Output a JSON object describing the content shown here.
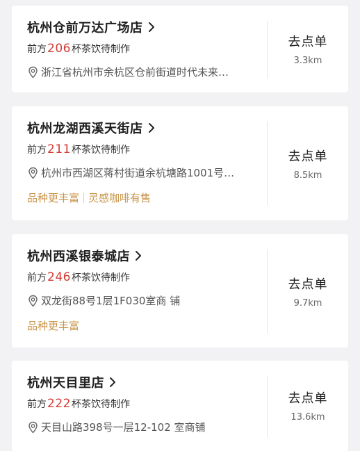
{
  "stores": [
    {
      "name": "杭州仓前万达广场店",
      "queue_prefix": "前方",
      "queue_count": "206",
      "queue_suffix": "杯茶饮待制作",
      "address": "浙江省杭州市余杭区仓前街道时代未来…",
      "tags": [],
      "order_label": "去点单",
      "distance": "3.3km"
    },
    {
      "name": "杭州龙湖西溪天街店",
      "queue_prefix": "前方",
      "queue_count": "211",
      "queue_suffix": "杯茶饮待制作",
      "address": "杭州市西湖区蒋村街道余杭塘路1001号…",
      "tags": [
        "品种更丰富",
        "灵感咖啡有售"
      ],
      "order_label": "去点单",
      "distance": "8.5km"
    },
    {
      "name": "杭州西溪银泰城店",
      "queue_prefix": "前方",
      "queue_count": "246",
      "queue_suffix": "杯茶饮待制作",
      "address": "双龙街88号1层1F030室商 铺",
      "tags": [
        "品种更丰富"
      ],
      "order_label": "去点单",
      "distance": "9.7km"
    },
    {
      "name": "杭州天目里店",
      "queue_prefix": "前方",
      "queue_count": "222",
      "queue_suffix": "杯茶饮待制作",
      "address": "天目山路398号一层12-102 室商铺",
      "tags": [],
      "order_label": "去点单",
      "distance": "13.6km"
    }
  ],
  "colors": {
    "queue_number": "#d33b36",
    "tag_text": "#c8954c",
    "card_background": "#ffffff",
    "page_background": "#f2f2f4"
  },
  "icons": {
    "chevron": "chevron-right-icon",
    "location": "location-pin-icon"
  }
}
